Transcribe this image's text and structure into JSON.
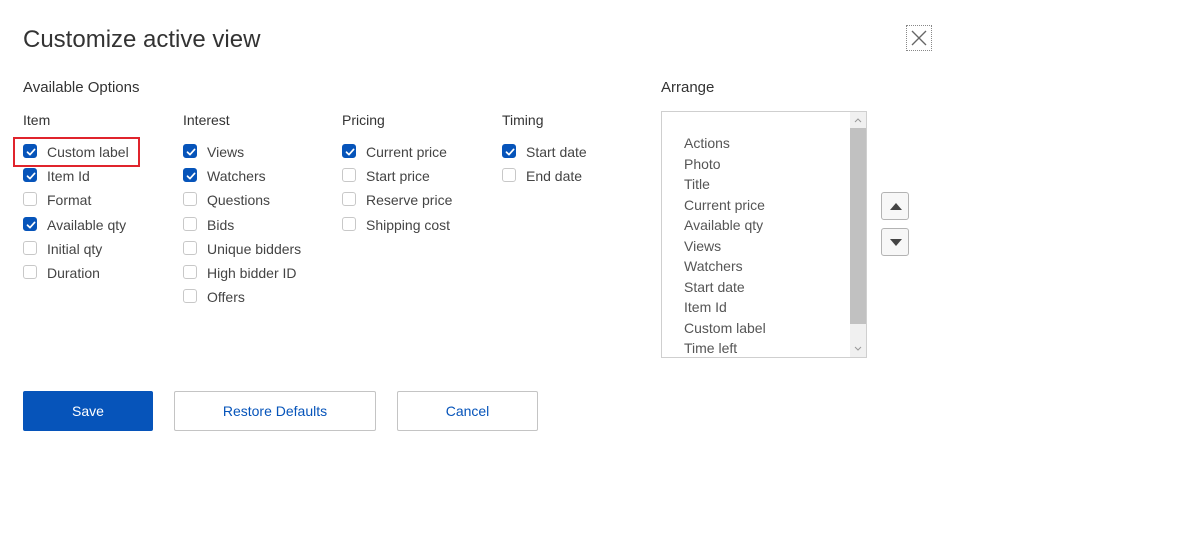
{
  "dialog": {
    "title": "Customize active view"
  },
  "available": {
    "heading": "Available Options",
    "columns": [
      {
        "header": "Item",
        "options": [
          {
            "label": "Custom label",
            "checked": true
          },
          {
            "label": "Item Id",
            "checked": true
          },
          {
            "label": "Format",
            "checked": false
          },
          {
            "label": "Available qty",
            "checked": true
          },
          {
            "label": "Initial qty",
            "checked": false
          },
          {
            "label": "Duration",
            "checked": false
          }
        ]
      },
      {
        "header": "Interest",
        "options": [
          {
            "label": "Views",
            "checked": true
          },
          {
            "label": "Watchers",
            "checked": true
          },
          {
            "label": "Questions",
            "checked": false
          },
          {
            "label": "Bids",
            "checked": false
          },
          {
            "label": "Unique bidders",
            "checked": false
          },
          {
            "label": "High bidder ID",
            "checked": false
          },
          {
            "label": "Offers",
            "checked": false
          }
        ]
      },
      {
        "header": "Pricing",
        "options": [
          {
            "label": "Current price",
            "checked": true
          },
          {
            "label": "Start price",
            "checked": false
          },
          {
            "label": "Reserve price",
            "checked": false
          },
          {
            "label": "Shipping cost",
            "checked": false
          }
        ]
      },
      {
        "header": "Timing",
        "options": [
          {
            "label": "Start date",
            "checked": true
          },
          {
            "label": "End date",
            "checked": false
          }
        ]
      }
    ]
  },
  "arrange": {
    "heading": "Arrange",
    "items": [
      "Actions",
      "Photo",
      "Title",
      "Current price",
      "Available qty",
      "Views",
      "Watchers",
      "Start date",
      "Item Id",
      "Custom label",
      "Time left"
    ]
  },
  "buttons": {
    "save": "Save",
    "restore": "Restore Defaults",
    "cancel": "Cancel"
  },
  "colors": {
    "primary": "#0654ba",
    "highlight": "#e0242c"
  }
}
